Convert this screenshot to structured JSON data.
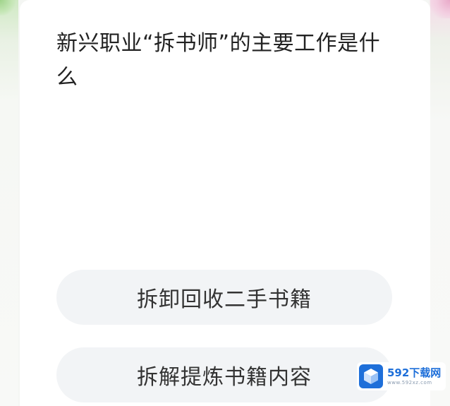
{
  "question": {
    "text": "新兴职业“拆书师”的主要工作是什么"
  },
  "options": [
    {
      "label": "拆卸回收二手书籍"
    },
    {
      "label": "拆解提炼书籍内容"
    }
  ],
  "watermark": {
    "name": "592下载网",
    "domain": "www.592xz.com",
    "icon": "cube-logo-icon",
    "brand_color": "#1e6fd9"
  },
  "colors": {
    "page_background": "#f4f6f3",
    "card_background": "#ffffff",
    "option_background": "#f2f4f6",
    "text_primary": "#222222"
  }
}
